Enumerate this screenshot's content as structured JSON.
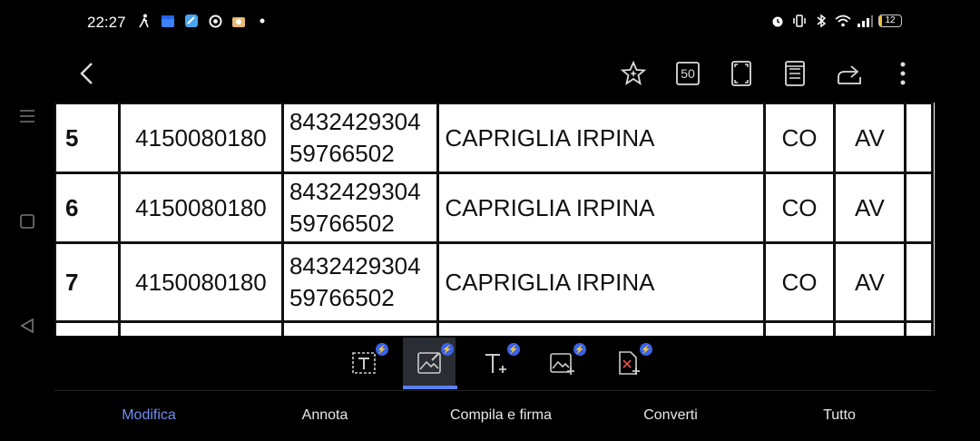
{
  "status": {
    "time": "22:27",
    "battery": "12"
  },
  "icons": {
    "left_status": [
      "walk-icon",
      "calendar-icon",
      "app-icon",
      "chrome-icon",
      "box-icon",
      "dot-icon"
    ],
    "right_status": [
      "alarm-icon",
      "vibrate-icon",
      "bluetooth-icon",
      "wifi-icon",
      "signal-icon"
    ]
  },
  "toolbar": {
    "page_number": "50"
  },
  "table": {
    "rows": [
      {
        "num": "5",
        "code": "4150080180",
        "id_line1": "8432429304",
        "id_line2": "59766502",
        "city": "CAPRIGLIA IRPINA",
        "co": "CO",
        "av": "AV"
      },
      {
        "num": "6",
        "code": "4150080180",
        "id_line1": "8432429304",
        "id_line2": "59766502",
        "city": "CAPRIGLIA IRPINA",
        "co": "CO",
        "av": "AV"
      },
      {
        "num": "7",
        "code": "4150080180",
        "id_line1": "8432429304",
        "id_line2": "59766502",
        "city": "CAPRIGLIA IRPINA",
        "co": "CO",
        "av": "AV"
      }
    ]
  },
  "tabs": {
    "modifica": "Modifica",
    "annota": "Annota",
    "compila": "Compila e firma",
    "converti": "Converti",
    "tutto": "Tutto"
  },
  "colors": {
    "accent": "#6f8ff0",
    "badge": "#3a63e6"
  }
}
